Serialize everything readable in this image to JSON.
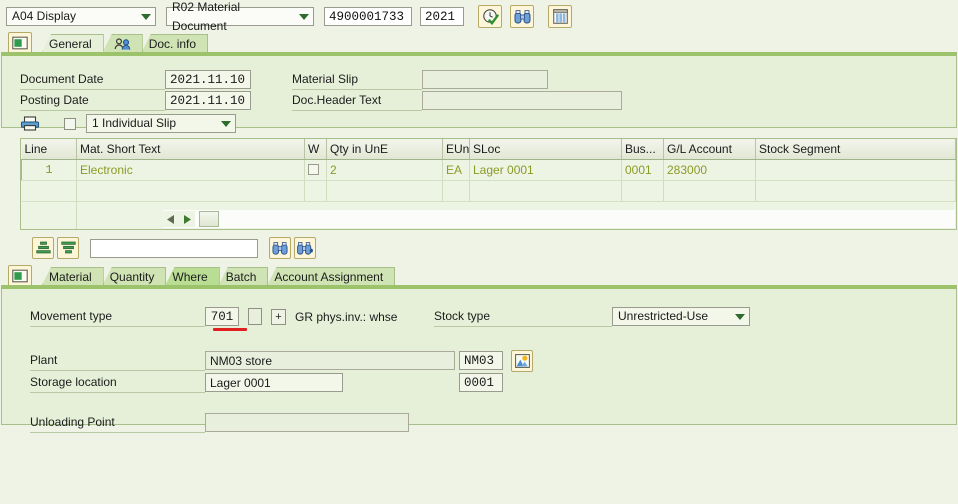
{
  "toolbar": {
    "mode_select": {
      "value": "A04 Display",
      "icon": "chevron-down-icon"
    },
    "object_select": {
      "value": "R02 Material Document",
      "icon": "chevron-down-icon"
    },
    "document_number": {
      "value": "4900001733",
      "placeholder": ""
    },
    "fiscal_year": {
      "value": "2021",
      "placeholder": ""
    },
    "buttons": [
      {
        "name": "enter-button",
        "icon": "clock-check-icon"
      },
      {
        "name": "find-button",
        "icon": "binoculars-icon"
      },
      {
        "name": "table-layout-button",
        "icon": "table-grid-icon"
      }
    ]
  },
  "header_tabs": {
    "folder_button_icon": "folder-open-icon",
    "items": [
      {
        "label": "General",
        "active": true,
        "icon": ""
      },
      {
        "label": "",
        "active": false,
        "icon": "people-icon"
      },
      {
        "label": "Doc. info",
        "active": false,
        "icon": ""
      }
    ]
  },
  "general": {
    "document_date": {
      "label": "Document Date",
      "value": "2021.11.10"
    },
    "posting_date": {
      "label": "Posting Date",
      "value": "2021.11.10"
    },
    "material_slip": {
      "label": "Material Slip",
      "value": "",
      "placeholder": ""
    },
    "doc_header_text": {
      "label": "Doc.Header Text",
      "value": "",
      "placeholder": ""
    },
    "print_icon": "printer-icon",
    "print_checkbox": {
      "checked": false
    },
    "slip_select": {
      "value": "1 Individual Slip",
      "icon": "chevron-down-icon"
    }
  },
  "grid": {
    "columns": [
      "Line",
      "Mat. Short Text",
      "W",
      "Qty in UnE",
      "EUn",
      "SLoc",
      "Bus...",
      "G/L Account",
      "Stock Segment"
    ],
    "rows": [
      {
        "line": "1",
        "mat_short_text": "Electronic",
        "w_checkbox": false,
        "qty_in_une": "2",
        "eun": "EA",
        "sloc": "Lager 0001",
        "bus": "0001",
        "gl_account": "283000",
        "stock_segment": ""
      },
      {
        "line": "",
        "mat_short_text": "",
        "w_checkbox": null,
        "qty_in_une": "",
        "eun": "",
        "sloc": "",
        "bus": "",
        "gl_account": "",
        "stock_segment": ""
      }
    ],
    "hscroll": {
      "left_icon": "triangle-left-icon",
      "right_icon": "triangle-right-icon"
    }
  },
  "grid_toolbar": {
    "sort_asc_icon": "sort-ascending-icon",
    "sort_desc_icon": "sort-descending-icon",
    "search_input": {
      "value": "",
      "placeholder": ""
    },
    "find_icon": "binoculars-icon",
    "find_next_icon": "binoculars-plus-icon"
  },
  "detail_tabs": {
    "folder_button_icon": "folder-open-icon",
    "items": [
      {
        "label": "Material",
        "active": false
      },
      {
        "label": "Quantity",
        "active": false
      },
      {
        "label": "Where",
        "active": true
      },
      {
        "label": "Batch",
        "active": false
      },
      {
        "label": "Account Assignment",
        "active": false
      }
    ]
  },
  "where": {
    "movement_type": {
      "label": "Movement type",
      "value": "701",
      "highlighted": true
    },
    "movement_type_checkbox": {
      "checked": false
    },
    "movement_plus_button": {
      "label": "+"
    },
    "movement_description": "GR phys.inv.: whse",
    "stock_type": {
      "label": "Stock type",
      "value": "Unrestricted-Use",
      "icon": "chevron-down-icon"
    },
    "plant": {
      "label": "Plant",
      "value": "NM03 store",
      "code": "NM03",
      "help_icon": "picture-help-icon"
    },
    "storage_location": {
      "label": "Storage location",
      "value": "Lager 0001",
      "code": "0001"
    },
    "unloading_point": {
      "label": "Unloading Point",
      "value": "",
      "placeholder": ""
    }
  },
  "colors": {
    "page_bg": "#eef3e6",
    "panel_bg": "#e6f0d8",
    "panel_border": "#a8bf89",
    "panel_top_band": "#9cc26c",
    "tab_inactive": "#cfe3b4",
    "grid_value_text": "#8a9a26",
    "line_cell": "#f6e79a",
    "annotation_red": "#e02020",
    "button_face": "#fdf6d8"
  }
}
